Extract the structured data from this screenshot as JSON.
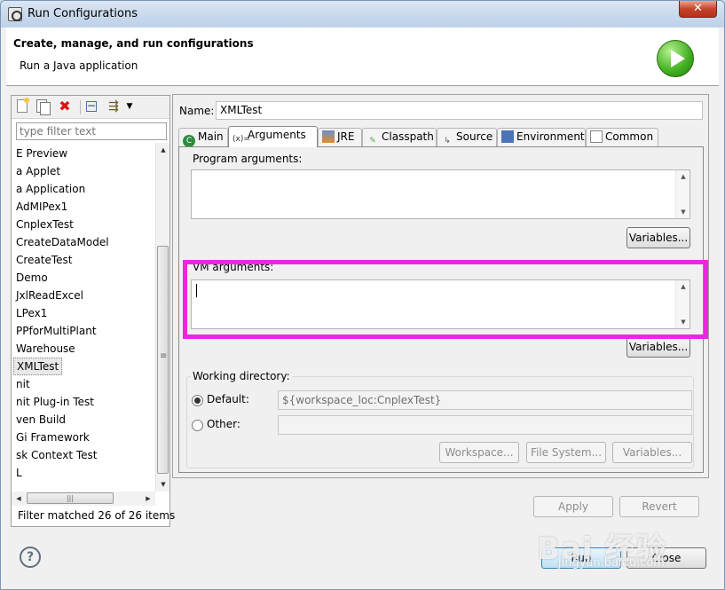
{
  "window": {
    "title": "Run Configurations",
    "close_glyph": "✕"
  },
  "header": {
    "title": "Create, manage, and run configurations",
    "subtitle": "Run a Java application",
    "icon": "run-icon"
  },
  "left_panel": {
    "filter_placeholder": "type filter text",
    "items": [
      "E Preview",
      "a Applet",
      "a Application",
      "AdMIPex1",
      "CnplexTest",
      "CreateDataModel",
      "CreateTest",
      "Demo",
      "JxlReadExcel",
      "LPex1",
      "PPforMultiPlant",
      "Warehouse",
      "XMLTest",
      "nit",
      "nit Plug-in Test",
      "ven Build",
      "Gi Framework",
      "sk Context Test",
      "L"
    ],
    "selected_item": "XMLTest",
    "status": "Filter matched 26 of 26 items"
  },
  "config": {
    "name_label": "Name:",
    "name_value": "XMLTest",
    "tabs": [
      "Main",
      "Arguments",
      "JRE",
      "Classpath",
      "Source",
      "Environment",
      "Common"
    ],
    "active_tab": "Arguments",
    "program_args_label": "Program arguments:",
    "program_args_value": "",
    "vm_args_label": "VM arguments:",
    "vm_args_value": "",
    "variables_label": "Variables...",
    "working_dir": {
      "label": "Working directory:",
      "default_label": "Default:",
      "default_value": "${workspace_loc:CnplexTest}",
      "other_label": "Other:",
      "other_value": "",
      "selected": "Default",
      "buttons": [
        "Workspace...",
        "File System...",
        "Variables..."
      ]
    }
  },
  "actions": {
    "apply": "Apply",
    "revert": "Revert",
    "run": "Run",
    "close": "Close"
  },
  "watermark": {
    "text": "Bai 经验",
    "sub": "jingyan.baidu.com"
  },
  "colors": {
    "highlight": "#ec26e0",
    "run_icon": "#3fae1f"
  }
}
